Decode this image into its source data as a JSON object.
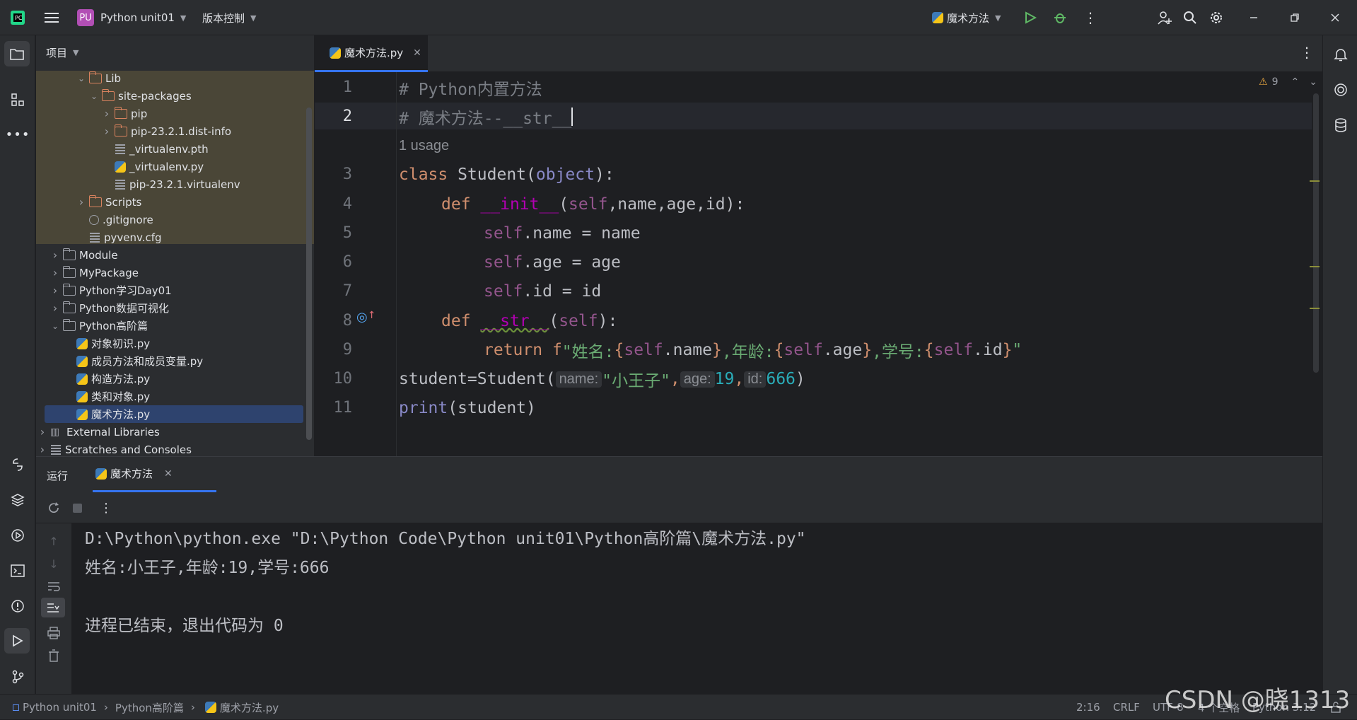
{
  "titlebar": {
    "project_badge": "PU",
    "project_name": "Python unit01",
    "vcs_label": "版本控制",
    "run_config": "魔术方法"
  },
  "project_panel": {
    "title": "项目",
    "items": [
      {
        "label": "Lib",
        "kind": "folder-orange",
        "expanded": true
      },
      {
        "label": "site-packages",
        "kind": "folder-orange",
        "expanded": true
      },
      {
        "label": "pip",
        "kind": "folder-orange",
        "expanded": false
      },
      {
        "label": "pip-23.2.1.dist-info",
        "kind": "folder-orange",
        "expanded": false
      },
      {
        "label": "_virtualenv.pth",
        "kind": "text"
      },
      {
        "label": "_virtualenv.py",
        "kind": "python"
      },
      {
        "label": "pip-23.2.1.virtualenv",
        "kind": "text"
      },
      {
        "label": "Scripts",
        "kind": "folder-orange",
        "expanded": false
      },
      {
        "label": ".gitignore",
        "kind": "ignore"
      },
      {
        "label": "pyvenv.cfg",
        "kind": "text"
      },
      {
        "label": "Module",
        "kind": "folder",
        "expanded": false
      },
      {
        "label": "MyPackage",
        "kind": "package",
        "expanded": false
      },
      {
        "label": "Python学习Day01",
        "kind": "folder",
        "expanded": false
      },
      {
        "label": "Python数据可视化",
        "kind": "folder",
        "expanded": false
      },
      {
        "label": "Python高阶篇",
        "kind": "folder",
        "expanded": true
      },
      {
        "label": "对象初识.py",
        "kind": "python"
      },
      {
        "label": "成员方法和成员变量.py",
        "kind": "python"
      },
      {
        "label": "构造方法.py",
        "kind": "python"
      },
      {
        "label": "类和对象.py",
        "kind": "python"
      },
      {
        "label": "魔术方法.py",
        "kind": "python",
        "selected": true
      },
      {
        "label": "External Libraries",
        "kind": "library",
        "expanded": false
      },
      {
        "label": "Scratches and Consoles",
        "kind": "scratch",
        "expanded": false
      }
    ]
  },
  "editor": {
    "tab_label": "魔术方法.py",
    "warnings_count": "9",
    "usage_hint": "1 usage",
    "line_numbers": [
      "1",
      "2",
      "3",
      "4",
      "5",
      "6",
      "7",
      "8",
      "9",
      "10",
      "11"
    ],
    "lines": {
      "l1": "# Python内置方法",
      "l2": "# 魔术方法--__str__",
      "l3_kw": "class",
      "l3_name": " Student(",
      "l3_base": "object",
      "l3_end": "):",
      "l4_def": "def",
      "l4_fn": "__init__",
      "l4_p1": "(",
      "l4_self": "self",
      "l4_rest": ",name,age,id):",
      "l5_self": "self",
      "l5_rest": ".name = name",
      "l6_self": "self",
      "l6_rest": ".age = age",
      "l7_self": "self",
      "l7_rest": ".id = id",
      "l8_def": "def",
      "l8_fn": "__str__",
      "l8_p1": "(",
      "l8_self": "self",
      "l8_end": "):",
      "l9_ret": "return",
      "l9_f": " f",
      "l9_s1": "\"姓名:",
      "l9_b1": "{",
      "l9_self1": "self",
      "l9_a1": ".name",
      "l9_b2": "}",
      "l9_s2": ",年龄:",
      "l9_b3": "{",
      "l9_self2": "self",
      "l9_a2": ".age",
      "l9_b4": "}",
      "l9_s3": ",学号:",
      "l9_b5": "{",
      "l9_self3": "self",
      "l9_a3": ".id",
      "l9_b6": "}",
      "l9_s4": "\"",
      "l10_a": "student=Student(",
      "l10_h1": "name:",
      "l10_v1": "\"小王子\"",
      "l10_c1": ",",
      "l10_h2": "age:",
      "l10_v2": "19",
      "l10_c2": ",",
      "l10_h3": "id:",
      "l10_v3": "666",
      "l10_end": ")",
      "l11_fn": "print",
      "l11_rest": "(student)"
    }
  },
  "run_panel": {
    "title": "运行",
    "tab_label": "魔术方法",
    "output": [
      "D:\\Python\\python.exe \"D:\\Python Code\\Python unit01\\Python高阶篇\\魔术方法.py\"",
      "姓名:小王子,年龄:19,学号:666",
      "",
      "进程已结束，退出代码为 0"
    ]
  },
  "statusbar": {
    "breadcrumb": [
      "Python unit01",
      "Python高阶篇",
      "魔术方法.py"
    ],
    "cursor": "2:16",
    "line_ending": "CRLF",
    "encoding": "UTF-8",
    "indent": "4 个空格",
    "interpreter": "Python 3.12"
  },
  "watermark": "CSDN @晓1313",
  "colors": {
    "accent": "#3574f0",
    "selection": "#2e436e",
    "badge": "#b24fb5"
  }
}
